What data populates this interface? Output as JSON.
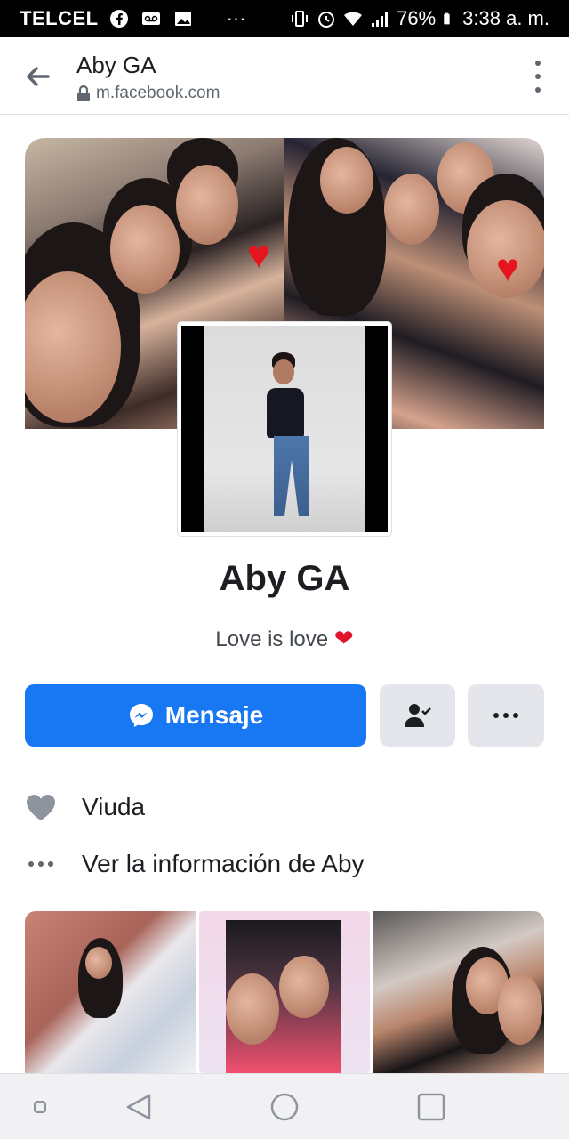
{
  "status_bar": {
    "carrier": "TELCEL",
    "dots": "···",
    "battery": "76%",
    "time": "3:38 a. m."
  },
  "header": {
    "title": "Aby GA",
    "url": "m.facebook.com"
  },
  "profile": {
    "name": "Aby GA",
    "bio": "Love is love",
    "bio_emoji": "❤",
    "message_label": "Mensaje"
  },
  "info": {
    "relationship": "Viuda",
    "see_about": "Ver la información de Aby"
  },
  "colors": {
    "accent": "#1877f2",
    "button_gray": "#e4e6eb",
    "heart": "#e0162b"
  },
  "icons": [
    "back-arrow-icon",
    "lock-icon",
    "more-vertical-icon",
    "messenger-icon",
    "friend-check-icon",
    "more-horizontal-icon",
    "heart-icon",
    "dots-icon"
  ]
}
